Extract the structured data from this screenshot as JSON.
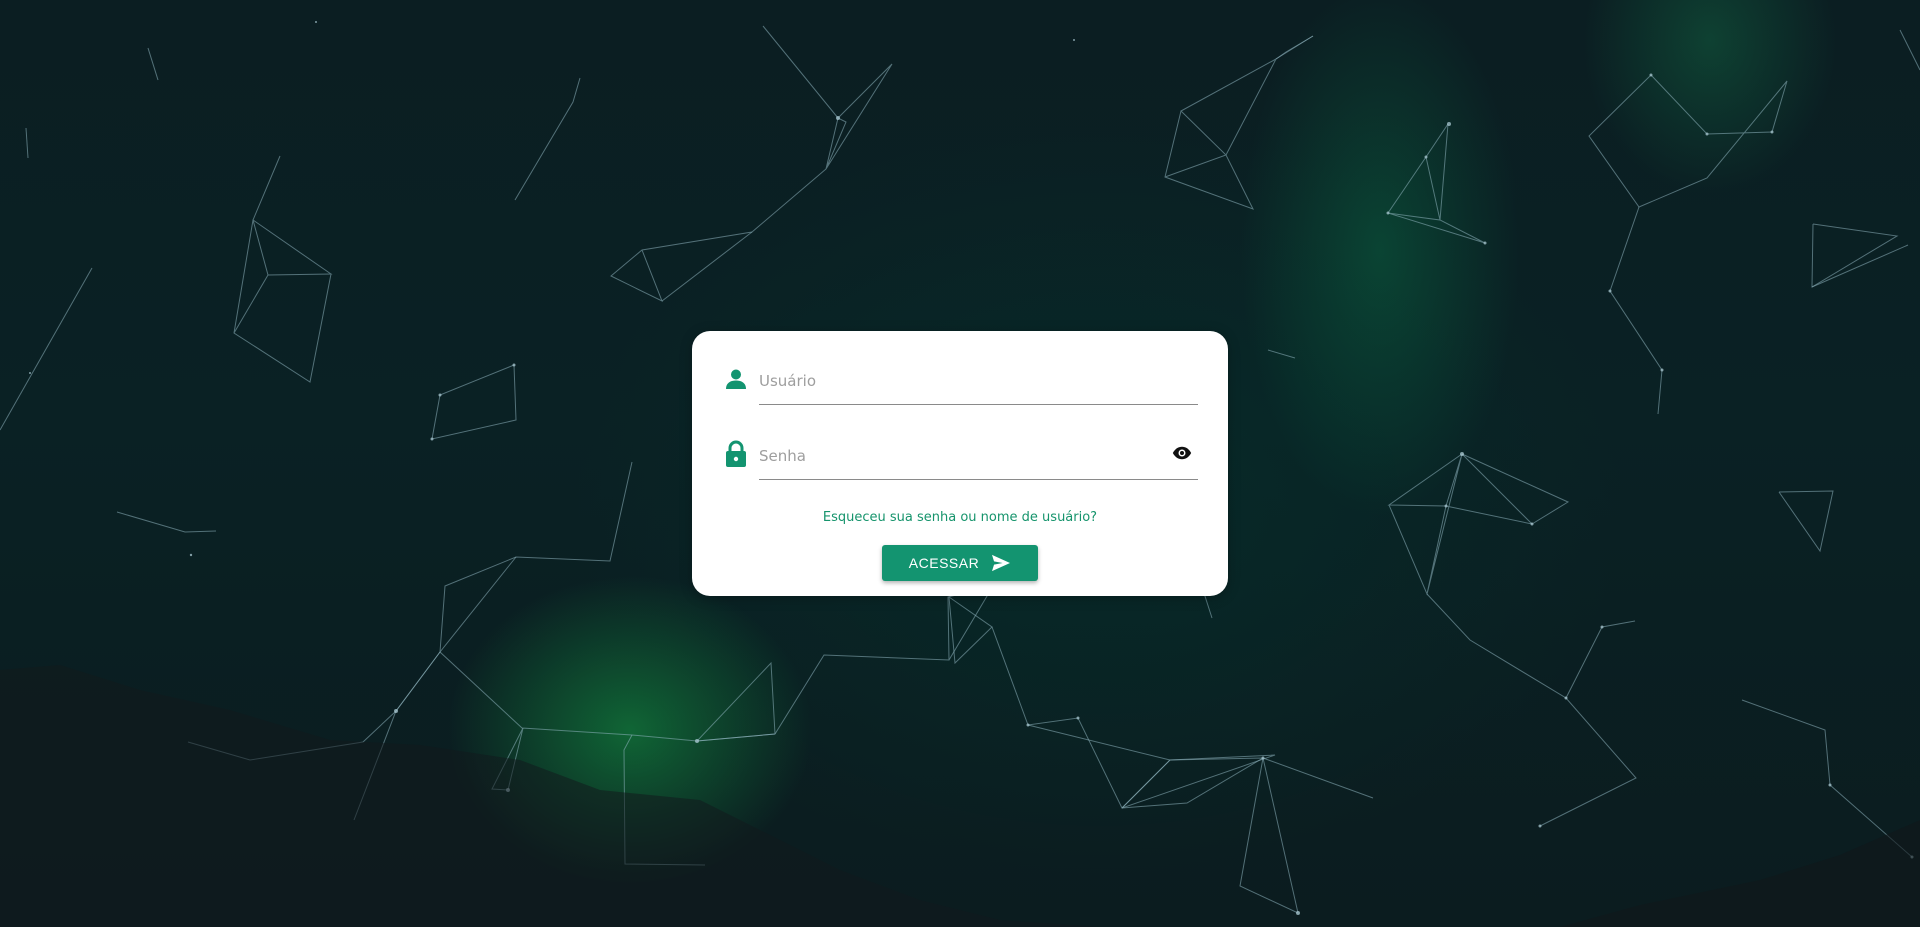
{
  "login_form": {
    "username_placeholder": "Usuário",
    "password_placeholder": "Senha",
    "forgot_link": "Esqueceu sua senha ou nome de usuário?",
    "submit_label": "ACESSAR"
  },
  "icons": {
    "username": "person-icon",
    "password": "lock-icon",
    "toggle_password": "eye-icon",
    "submit": "send-icon"
  },
  "colors": {
    "accent": "#139470",
    "link": "#16946c",
    "background": "#0b1e22",
    "card": "#ffffff"
  }
}
